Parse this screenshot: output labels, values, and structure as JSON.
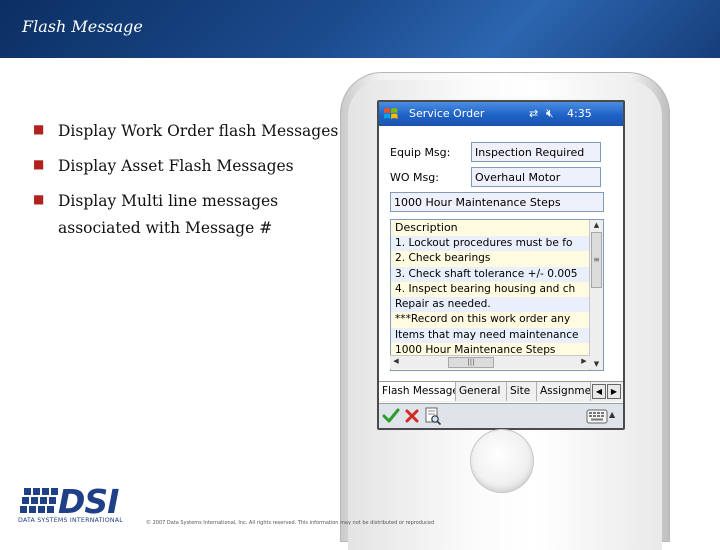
{
  "slide": {
    "title": "Flash Message",
    "bullets": [
      "Display Work Order flash Messages",
      "Display Asset Flash Messages",
      "Display Multi line messages associated with Message #"
    ],
    "footer": "© 2007 Data Systems International, Inc. All rights reserved. This information may not be distributed or reproduced",
    "logo": {
      "text": "DSI",
      "subtext": "DATA SYSTEMS INTERNATIONAL",
      "color": "#1f3f86"
    }
  },
  "pda": {
    "app_title": "Service Order",
    "time": "4:35",
    "icons": [
      "windows-flag-icon",
      "sync-icon",
      "volume-mute-icon"
    ],
    "equip_label": "Equip Msg:",
    "equip_value": "Inspection Required",
    "wo_label": "WO Msg:",
    "wo_value": "Overhaul Motor",
    "message_title": "1000 Hour Maintenance Steps",
    "description_header": "Description",
    "description_lines": [
      "1.  Lockout procedures must be fo",
      "2.  Check bearings",
      "3.  Check shaft tolerance +/- 0.005",
      "4.  Inspect bearing housing and ch",
      "Repair as needed.",
      "***Record on this work order any",
      "Items that may need maintenance",
      "1000 Hour Maintenance Steps"
    ],
    "tabs": [
      "Flash Message",
      "General",
      "Site",
      "Assignment"
    ],
    "tab_prev": "◀",
    "tab_next": "▶",
    "toolbar_icons": [
      "checkmark-icon",
      "cancel-icon",
      "document-search-icon",
      "keyboard-icon"
    ],
    "accent": "#1f62c8"
  }
}
